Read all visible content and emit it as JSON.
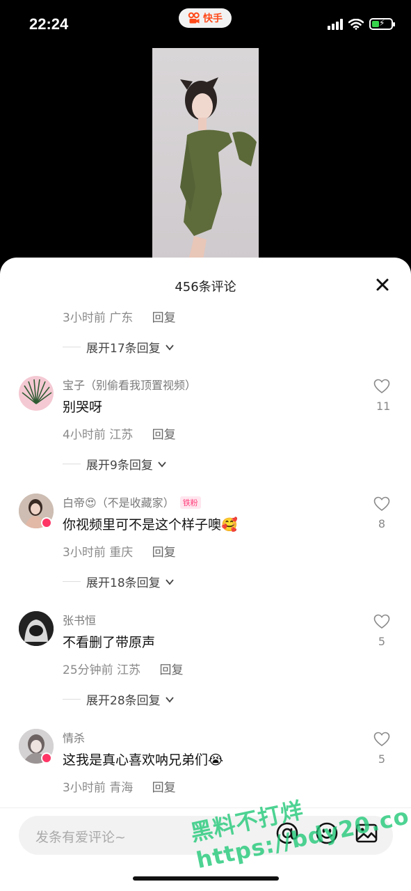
{
  "status_bar": {
    "time": "22:24",
    "app_name": "快手"
  },
  "sheet": {
    "title": "456条评论"
  },
  "top_thread": {
    "meta_time": "3小时前",
    "meta_region": "广东",
    "reply_label": "回复",
    "expand_label": "展开17条回复"
  },
  "comments": [
    {
      "username": "宝子（别偷看我顶置视频）",
      "badge": "",
      "text": "别哭呀",
      "time": "4小时前",
      "region": "江苏",
      "reply_label": "回复",
      "likes": "11",
      "expand_label": "展开9条回复"
    },
    {
      "username": "白帝😍（不是收藏家）",
      "badge": "铁粉",
      "text": "你视频里可不是这个样子噢🥰",
      "time": "3小时前",
      "region": "重庆",
      "reply_label": "回复",
      "likes": "8",
      "expand_label": "展开18条回复"
    },
    {
      "username": "张书恒",
      "badge": "",
      "text": "不看删了带原声",
      "time": "25分钟前",
      "region": "江苏",
      "reply_label": "回复",
      "likes": "5",
      "expand_label": "展开28条回复"
    },
    {
      "username": "情杀",
      "badge": "",
      "text": "这我是真心喜欢呐兄弟们😭",
      "time": "3小时前",
      "region": "青海",
      "reply_label": "回复",
      "likes": "5",
      "expand_label": ""
    }
  ],
  "input": {
    "placeholder": "发条有爱评论~"
  },
  "watermark": "黑料不打烊 https://bdy20.co",
  "colors": {
    "accent": "#ff4a1a",
    "verified": "#fe3666",
    "badge": "#ff3b7a"
  }
}
